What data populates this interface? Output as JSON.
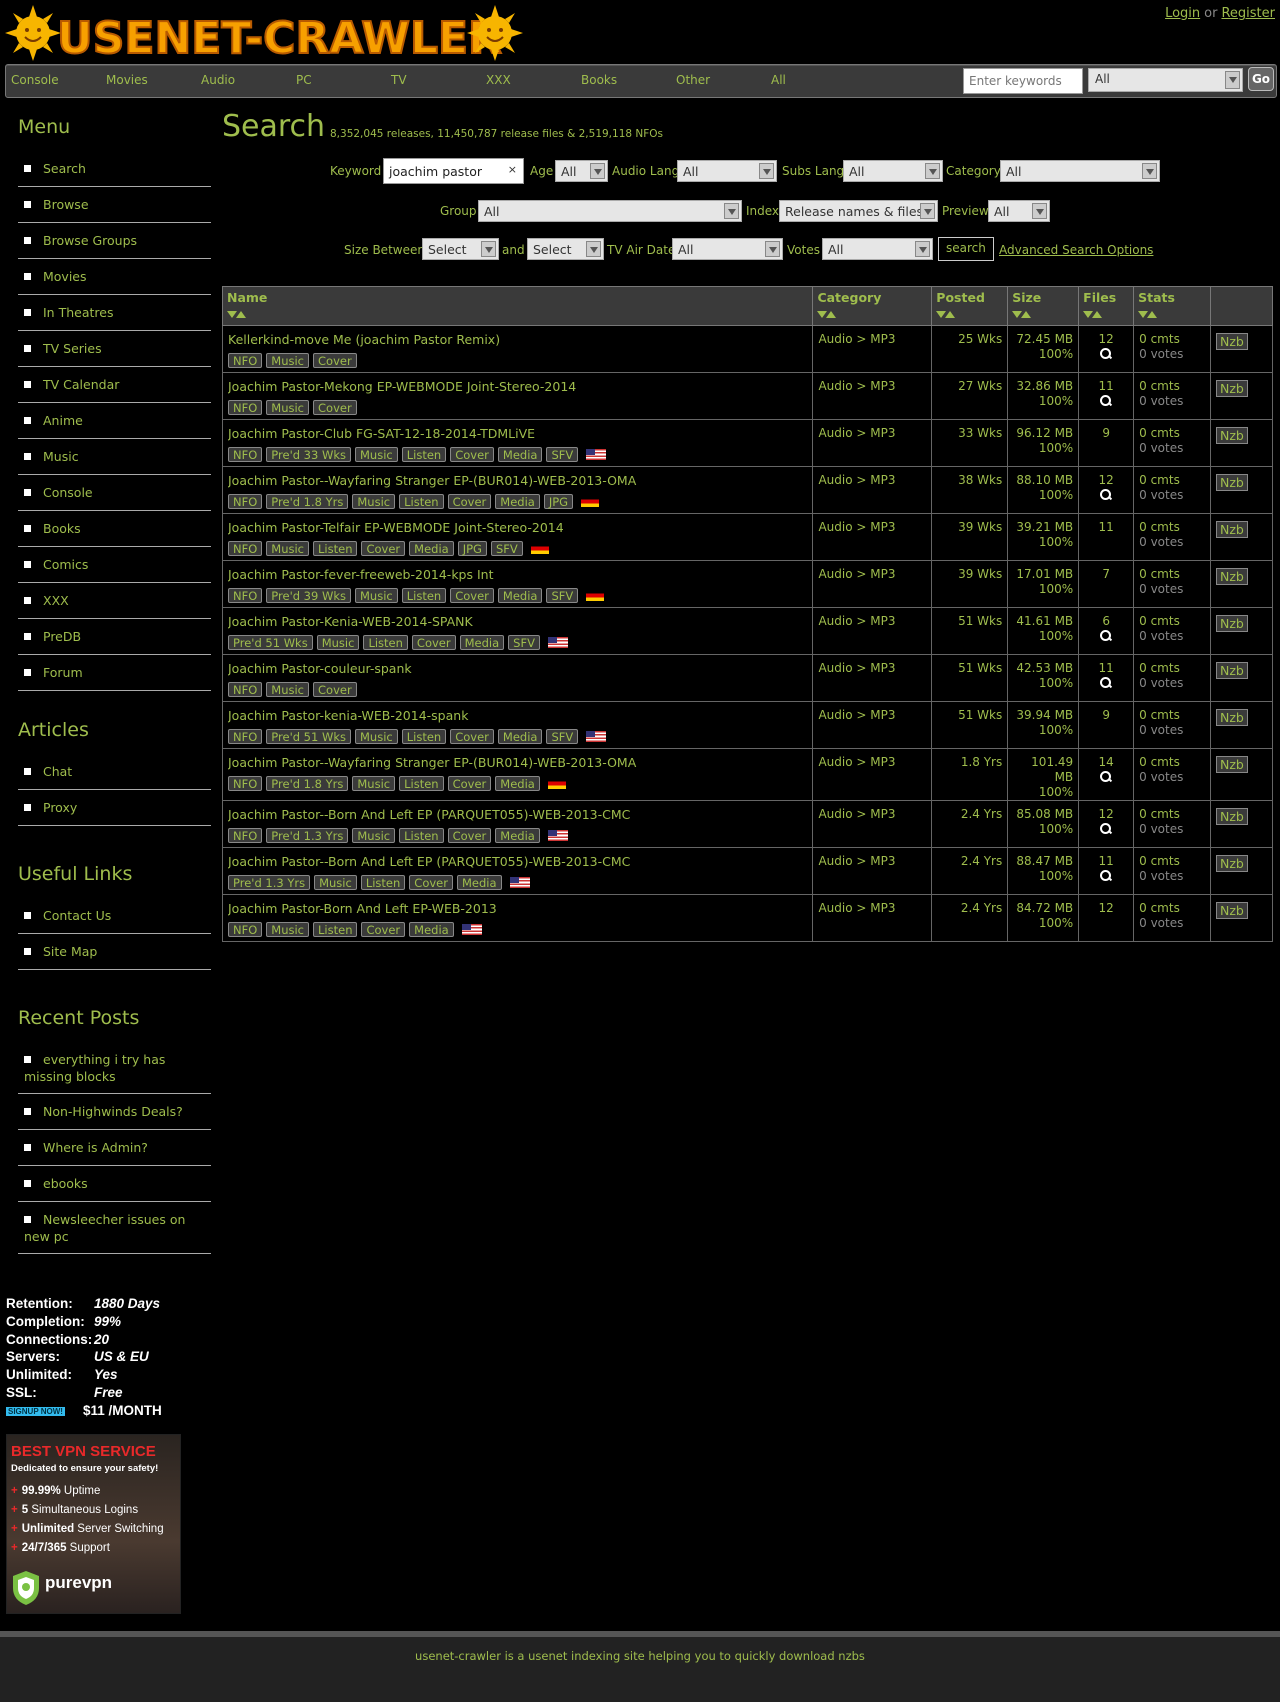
{
  "site": {
    "logo_text": "USENET-CRAWLER",
    "login": "Login",
    "or": "or",
    "register": "Register"
  },
  "nav": {
    "items": [
      "Console",
      "Movies",
      "Audio",
      "PC",
      "TV",
      "XXX",
      "Books",
      "Other",
      "All"
    ],
    "search_placeholder": "Enter keywords",
    "category_value": "All",
    "go": "Go"
  },
  "sidebar": {
    "menu_title": "Menu",
    "menu": [
      "Search",
      "Browse",
      "Browse Groups",
      "Movies",
      "In Theatres",
      "TV Series",
      "TV Calendar",
      "Anime",
      "Music",
      "Console",
      "Books",
      "Comics",
      "XXX",
      "PreDB",
      "Forum"
    ],
    "articles_title": "Articles",
    "articles": [
      "Chat",
      "Proxy"
    ],
    "links_title": "Useful Links",
    "links": [
      "Contact Us",
      "Site Map"
    ],
    "posts_title": "Recent Posts",
    "posts": [
      "everything i try has missing blocks",
      "Non-Highwinds Deals?",
      "Where is Admin?",
      "ebooks",
      "Newsleecher issues on new pc"
    ]
  },
  "promo": {
    "rows": [
      {
        "k": "Retention:",
        "v": "1880 Days"
      },
      {
        "k": "Completion:",
        "v": "99%"
      },
      {
        "k": "Connections:",
        "v": "20"
      },
      {
        "k": "Servers:",
        "v": "US & EU"
      },
      {
        "k": "Unlimited:",
        "v": "Yes"
      },
      {
        "k": "SSL:",
        "v": "Free"
      }
    ],
    "signup": "SIGNUP NOW!",
    "price": "$11 /MONTH"
  },
  "vpn": {
    "title": "BEST VPN SERVICE",
    "subtitle": "Dedicated to ensure your safety!",
    "features": [
      {
        "b": "99.99%",
        "t": " Uptime"
      },
      {
        "b": "5",
        "t": " Simultaneous Logins"
      },
      {
        "b": "Unlimited",
        "t": " Server Switching"
      },
      {
        "b": "24/7/365",
        "t": " Support"
      }
    ],
    "brand": "purevpn"
  },
  "search": {
    "title": "Search",
    "stats": "8,352,045 releases, 11,450,787 release files & 2,519,118 NFOs",
    "keyword_label": "Keyword",
    "keyword_value": "joachim pastor",
    "clear": "×",
    "age_label": "Age",
    "age_value": "All",
    "audio_label": "Audio Lang",
    "audio_value": "All",
    "subs_label": "Subs Lang",
    "subs_value": "All",
    "category_label": "Category",
    "category_value": "All",
    "group_label": "Group",
    "group_value": "All",
    "index_label": "Index",
    "index_value": "Release names & files",
    "preview_label": "Preview",
    "preview_value": "All",
    "size_label": "Size Between",
    "size_min": "Select",
    "and": "and",
    "size_max": "Select",
    "tvair_label": "TV Air Date",
    "tvair_value": "All",
    "votes_label": "Votes",
    "votes_value": "All",
    "button": "search",
    "advanced": "Advanced Search Options"
  },
  "table": {
    "headers": [
      "Name",
      "Category",
      "Posted",
      "Size",
      "Files",
      "Stats",
      ""
    ],
    "nzb": "Nzb",
    "rows": [
      {
        "name": "Kellerkind-move Me (joachim Pastor Remix)",
        "tags": [
          "NFO",
          "Music",
          "Cover"
        ],
        "flag": "",
        "cat": "Audio > MP3",
        "posted": "25 Wks",
        "size": "72.45 MB",
        "pct": "100%",
        "files": "12",
        "preview": true,
        "cmts": "0 cmts",
        "votes": "0 votes"
      },
      {
        "name": "Joachim Pastor-Mekong EP-WEBMODE Joint-Stereo-2014",
        "tags": [
          "NFO",
          "Music",
          "Cover"
        ],
        "flag": "",
        "cat": "Audio > MP3",
        "posted": "27 Wks",
        "size": "32.86 MB",
        "pct": "100%",
        "files": "11",
        "preview": true,
        "cmts": "0 cmts",
        "votes": "0 votes"
      },
      {
        "name": "Joachim Pastor-Club FG-SAT-12-18-2014-TDMLiVE",
        "tags": [
          "NFO",
          "Pre'd 33 Wks",
          "Music",
          "Listen",
          "Cover",
          "Media",
          "SFV"
        ],
        "flag": "us",
        "cat": "Audio > MP3",
        "posted": "33 Wks",
        "size": "96.12 MB",
        "pct": "100%",
        "files": "9",
        "preview": false,
        "cmts": "0 cmts",
        "votes": "0 votes"
      },
      {
        "name": "Joachim Pastor--Wayfaring Stranger EP-(BUR014)-WEB-2013-OMA",
        "tags": [
          "NFO",
          "Pre'd 1.8 Yrs",
          "Music",
          "Listen",
          "Cover",
          "Media",
          "JPG"
        ],
        "flag": "de",
        "cat": "Audio > MP3",
        "posted": "38 Wks",
        "size": "88.10 MB",
        "pct": "100%",
        "files": "12",
        "preview": true,
        "cmts": "0 cmts",
        "votes": "0 votes"
      },
      {
        "name": "Joachim Pastor-Telfair EP-WEBMODE Joint-Stereo-2014",
        "tags": [
          "NFO",
          "Music",
          "Listen",
          "Cover",
          "Media",
          "JPG",
          "SFV"
        ],
        "flag": "de",
        "cat": "Audio > MP3",
        "posted": "39 Wks",
        "size": "39.21 MB",
        "pct": "100%",
        "files": "11",
        "preview": false,
        "cmts": "0 cmts",
        "votes": "0 votes"
      },
      {
        "name": "Joachim Pastor-fever-freeweb-2014-kps Int",
        "tags": [
          "NFO",
          "Pre'd 39 Wks",
          "Music",
          "Listen",
          "Cover",
          "Media",
          "SFV"
        ],
        "flag": "de",
        "cat": "Audio > MP3",
        "posted": "39 Wks",
        "size": "17.01 MB",
        "pct": "100%",
        "files": "7",
        "preview": false,
        "cmts": "0 cmts",
        "votes": "0 votes"
      },
      {
        "name": "Joachim Pastor-Kenia-WEB-2014-SPANK",
        "tags": [
          "Pre'd 51 Wks",
          "Music",
          "Listen",
          "Cover",
          "Media",
          "SFV"
        ],
        "flag": "us",
        "cat": "Audio > MP3",
        "posted": "51 Wks",
        "size": "41.61 MB",
        "pct": "100%",
        "files": "6",
        "preview": true,
        "cmts": "0 cmts",
        "votes": "0 votes"
      },
      {
        "name": "Joachim Pastor-couleur-spank",
        "tags": [
          "NFO",
          "Music",
          "Cover"
        ],
        "flag": "",
        "cat": "Audio > MP3",
        "posted": "51 Wks",
        "size": "42.53 MB",
        "pct": "100%",
        "files": "11",
        "preview": true,
        "cmts": "0 cmts",
        "votes": "0 votes"
      },
      {
        "name": "Joachim Pastor-kenia-WEB-2014-spank",
        "tags": [
          "NFO",
          "Pre'd 51 Wks",
          "Music",
          "Listen",
          "Cover",
          "Media",
          "SFV"
        ],
        "flag": "us",
        "cat": "Audio > MP3",
        "posted": "51 Wks",
        "size": "39.94 MB",
        "pct": "100%",
        "files": "9",
        "preview": false,
        "cmts": "0 cmts",
        "votes": "0 votes"
      },
      {
        "name": "Joachim Pastor--Wayfaring Stranger EP-(BUR014)-WEB-2013-OMA",
        "tags": [
          "NFO",
          "Pre'd 1.8 Yrs",
          "Music",
          "Listen",
          "Cover",
          "Media"
        ],
        "flag": "de",
        "cat": "Audio > MP3",
        "posted": "1.8 Yrs",
        "size": "101.49 MB",
        "pct": "100%",
        "files": "14",
        "preview": true,
        "cmts": "0 cmts",
        "votes": "0 votes"
      },
      {
        "name": "Joachim Pastor--Born And Left EP (PARQUET055)-WEB-2013-CMC",
        "tags": [
          "NFO",
          "Pre'd 1.3 Yrs",
          "Music",
          "Listen",
          "Cover",
          "Media"
        ],
        "flag": "us",
        "cat": "Audio > MP3",
        "posted": "2.4 Yrs",
        "size": "85.08 MB",
        "pct": "100%",
        "files": "12",
        "preview": true,
        "cmts": "0 cmts",
        "votes": "0 votes"
      },
      {
        "name": "Joachim Pastor--Born And Left EP (PARQUET055)-WEB-2013-CMC",
        "tags": [
          "Pre'd 1.3 Yrs",
          "Music",
          "Listen",
          "Cover",
          "Media"
        ],
        "flag": "us",
        "cat": "Audio > MP3",
        "posted": "2.4 Yrs",
        "size": "88.47 MB",
        "pct": "100%",
        "files": "11",
        "preview": true,
        "cmts": "0 cmts",
        "votes": "0 votes"
      },
      {
        "name": "Joachim Pastor-Born And Left EP-WEB-2013",
        "tags": [
          "NFO",
          "Music",
          "Listen",
          "Cover",
          "Media"
        ],
        "flag": "us",
        "cat": "Audio > MP3",
        "posted": "2.4 Yrs",
        "size": "84.72 MB",
        "pct": "100%",
        "files": "12",
        "preview": false,
        "cmts": "0 cmts",
        "votes": "0 votes"
      }
    ]
  },
  "footer": {
    "text": "usenet-crawler is a usenet indexing site helping you to quickly download nzbs"
  }
}
